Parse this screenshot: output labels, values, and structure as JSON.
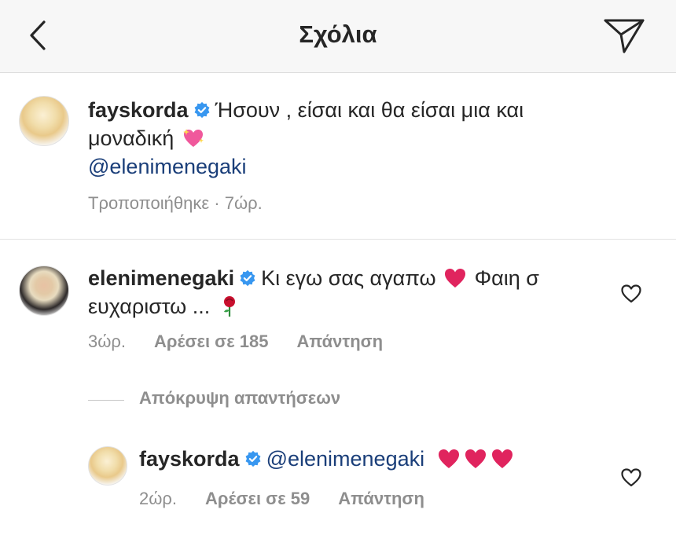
{
  "header": {
    "title": "Σχόλια",
    "back_icon": "chevron-left-icon",
    "share_icon": "paper-plane-icon"
  },
  "comments": [
    {
      "username": "fayskorda",
      "verified": true,
      "text_line1": "Ήσουν , είσαι και θα είσαι μια και",
      "text_line2": "μοναδική",
      "emoji": "sparkling-heart",
      "mention": "@elenimenegaki",
      "meta": "Τροποποιήθηκε · 7ώρ."
    },
    {
      "username": "elenimenegaki",
      "verified": true,
      "text_line1a": "Κι εγω σας αγαπω",
      "text_line1b": "Φαιη σ",
      "text_line2": "ευχαριστω ...",
      "emojis": [
        "red-heart",
        "rose"
      ],
      "time": "3ώρ.",
      "likes": "Αρέσει σε 185",
      "reply": "Απάντηση"
    }
  ],
  "hide_replies": "Απόκρυψη απαντήσεων",
  "reply": {
    "username": "fayskorda",
    "verified": true,
    "mention": "@elenimenegaki",
    "emojis": [
      "red-heart",
      "red-heart",
      "red-heart"
    ],
    "time": "2ώρ.",
    "likes": "Αρέσει σε 59",
    "reply": "Απάντηση"
  },
  "colors": {
    "header_bg": "#f7f7f7",
    "text": "#262626",
    "secondary": "#8e8e8e",
    "mention": "#1a3e79",
    "verified": "#3897f0",
    "heart": "#e0245e"
  }
}
